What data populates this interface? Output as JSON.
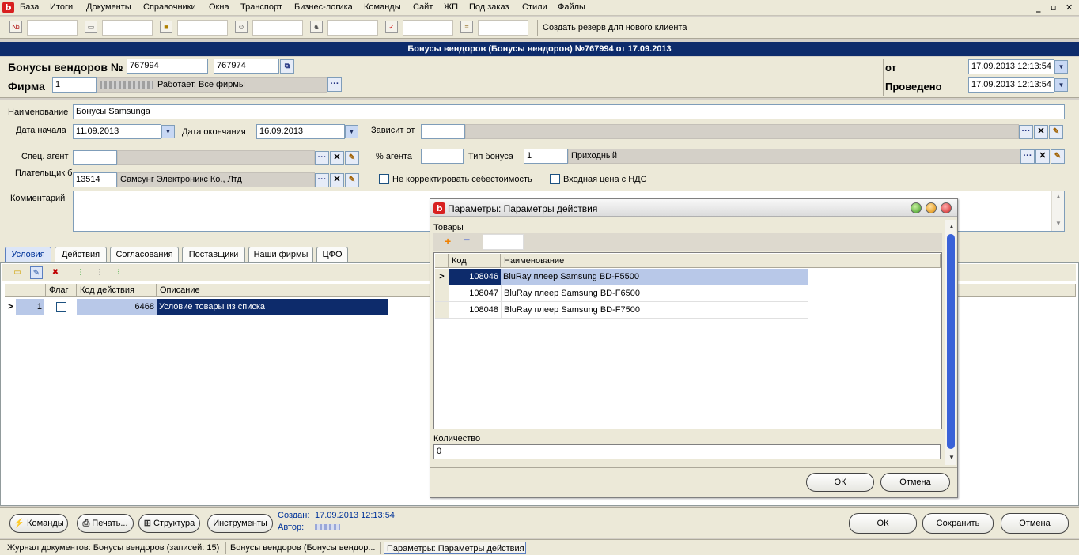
{
  "menu": {
    "items": [
      "База",
      "Итоги",
      "Документы",
      "Справочники",
      "Окна",
      "Транспорт",
      "Бизнес-логика",
      "Команды",
      "Сайт",
      "ЖП",
      "Под заказ",
      "Стили",
      "Файлы"
    ],
    "win_min": "_",
    "win_restore": "▫",
    "win_close": "✕"
  },
  "toolbar": {
    "create_reserve": "Создать резерв для нового клиента"
  },
  "doc": {
    "window_title": "Бонусы вендоров (Бонусы вендоров) №767994 от 17.09.2013",
    "number_label": "Бонусы вендоров №",
    "number_value": "767994",
    "number_value2": "767974",
    "firm_label": "Фирма",
    "firm_code": "1",
    "firm_desc": "Работает, Все фирмы",
    "from_label": "от",
    "from_value": "17.09.2013 12:13:54",
    "posted_label": "Проведено",
    "posted_value": "17.09.2013 12:13:54"
  },
  "form": {
    "name_label": "Наименование",
    "name_value": "Бонусы Samsunga",
    "start_label": "Дата начала",
    "start_value": "11.09.2013",
    "end_label": "Дата окончания",
    "end_value": "16.09.2013",
    "depends_label": "Зависит от",
    "agent_label": "Спец. агент",
    "agent_pct_label": "% агента",
    "bonus_type_label": "Тип бонуса",
    "bonus_type_code": "1",
    "bonus_type_value": "Приходный",
    "payer_label": "Плательщик б",
    "payer_code": "13514",
    "payer_value": "Самсунг Электроникс Ко., Лтд",
    "no_adjust_label": "Не корректировать себестоимость",
    "vat_label": "Входная цена с НДС",
    "comment_label": "Комментарий"
  },
  "tabs": [
    "Условия",
    "Действия",
    "Согласования",
    "Поставщики",
    "Наши фирмы",
    "ЦФО"
  ],
  "grid": {
    "headers": [
      "Флаг",
      "Код действия",
      "Описание"
    ],
    "rows": [
      {
        "num": "1",
        "code": "6468",
        "desc": "Условие товары из списка"
      }
    ]
  },
  "bottom": {
    "commands": "Команды",
    "print": "Печать...",
    "structure": "Структура",
    "tools": "Инструменты",
    "created_label": "Создан:",
    "created_value": "17.09.2013 12:13:54",
    "author_label": "Автор:",
    "ok": "ОК",
    "save": "Сохранить",
    "cancel": "Отмена"
  },
  "status": {
    "items": [
      "Журнал документов: Бонусы вендоров (записей: 15)",
      "Бонусы вендоров (Бонусы вендор...",
      "Параметры: Параметры действия"
    ]
  },
  "modal": {
    "title": "Параметры: Параметры действия",
    "goods_label": "Товары",
    "headers": [
      "Код",
      "Наименование"
    ],
    "rows": [
      {
        "code": "108046",
        "name": "BluRay плеер Samsung BD-F5500"
      },
      {
        "code": "108047",
        "name": "BluRay плеер Samsung BD-F6500"
      },
      {
        "code": "108048",
        "name": "BluRay плеер Samsung BD-F7500"
      }
    ],
    "qty_label": "Количество",
    "qty_value": "0",
    "ok": "ОК",
    "cancel": "Отмена"
  },
  "colors": {
    "title_bar": "#0d2b6b",
    "selected_row": "#0d2b6b",
    "selected_cell": "#b8c8e8"
  }
}
